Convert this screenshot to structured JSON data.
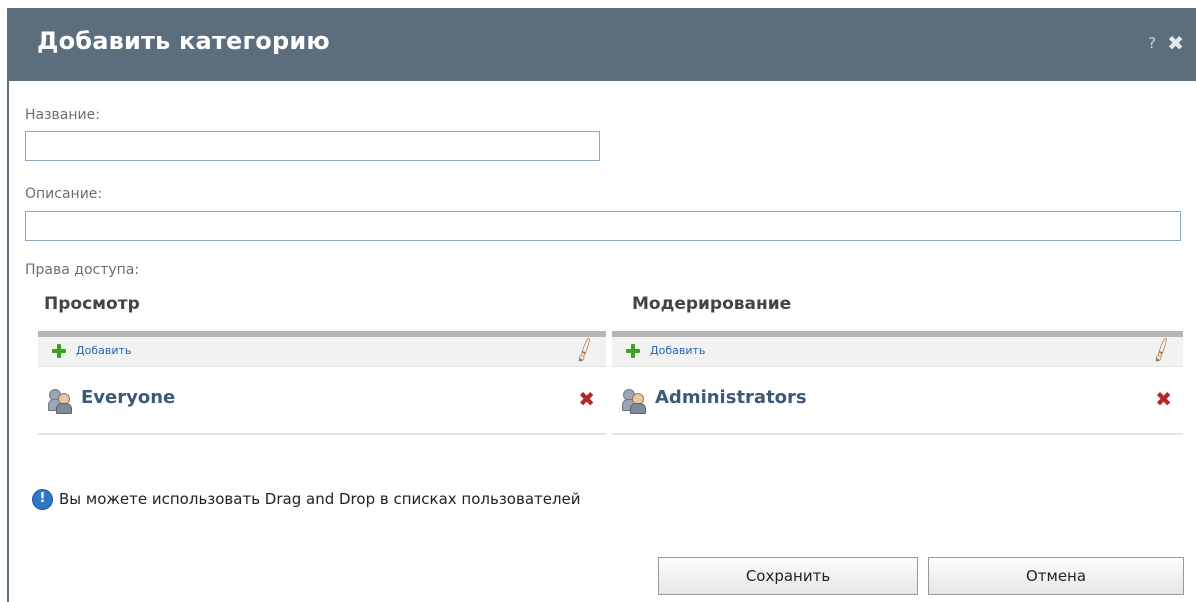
{
  "dialog": {
    "title": "Добавить категорию",
    "help_label": "?",
    "close_label": "✖"
  },
  "form": {
    "name_label": "Название:",
    "name_value": "",
    "description_label": "Описание:",
    "description_value": "",
    "access_label": "Права доступа:"
  },
  "permissions": {
    "view": {
      "title": "Просмотр",
      "add_label": "Добавить",
      "entries": [
        "Everyone"
      ]
    },
    "moderation": {
      "title": "Модерирование",
      "add_label": "Добавить",
      "entries": [
        "Administrators"
      ]
    }
  },
  "info": {
    "icon": "info-icon",
    "text": "Вы можете использовать Drag and Drop в списках пользователей"
  },
  "buttons": {
    "save": "Сохранить",
    "cancel": "Отмена"
  },
  "colors": {
    "titlebar": "#5c6d7e",
    "user_name": "#3d5978",
    "link": "#2a62b5",
    "remove": "#b52727",
    "add": "#3aa421"
  }
}
